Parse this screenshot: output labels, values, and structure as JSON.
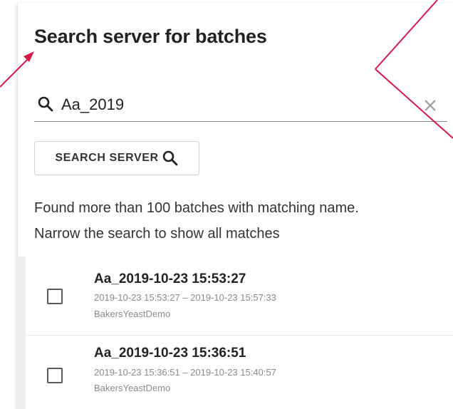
{
  "panel": {
    "title": "Search server for batches"
  },
  "search": {
    "value": "Aa_2019",
    "icon": "search-icon",
    "clear_icon": "close-icon"
  },
  "search_server_button": {
    "label": "SEARCH SERVER",
    "icon": "search-icon"
  },
  "message": {
    "line1": "Found more than 100 batches with matching name.",
    "line2": "Narrow the search to show all matches"
  },
  "results": [
    {
      "name": "Aa_2019-10-23 15:53:27",
      "range": "2019-10-23 15:53:27 – 2019-10-23 15:57:33",
      "project": "BakersYeastDemo",
      "checked": false
    },
    {
      "name": "Aa_2019-10-23 15:36:51",
      "range": "2019-10-23 15:36:51 – 2019-10-23 15:40:57",
      "project": "BakersYeastDemo",
      "checked": false
    }
  ],
  "colors": {
    "annotation_arrow": "#d11a4a",
    "text_primary": "#222222",
    "text_secondary": "#8a8a8a"
  }
}
